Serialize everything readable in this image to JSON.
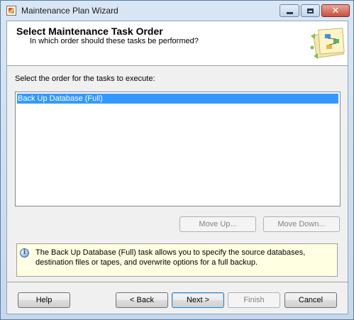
{
  "window": {
    "title": "Maintenance Plan Wizard",
    "app_icon": "wizard-app-icon"
  },
  "caption_buttons": {
    "minimize_icon": "minimize-icon",
    "maximize_icon": "maximize-icon",
    "close_icon": "close-icon",
    "close_glyph": "✕"
  },
  "header": {
    "title": "Select Maintenance Task Order",
    "subtitle": "In which order should these tasks be performed?",
    "graphic_icon": "wizard-header-graphic"
  },
  "task_section": {
    "label": "Select the order for the tasks to execute:",
    "tasks": [
      {
        "label": "Back Up Database (Full)",
        "selected": true
      }
    ]
  },
  "order_buttons": {
    "move_up": "Move Up...",
    "move_down": "Move Down..."
  },
  "info": {
    "icon": "info-icon",
    "glyph": "i",
    "text": "The Back Up Database (Full) task allows you to specify the source databases, destination files or tapes, and overwrite options for a full backup."
  },
  "footer": {
    "help": "Help",
    "back": "< Back",
    "next": "Next >",
    "finish": "Finish",
    "cancel": "Cancel"
  },
  "colors": {
    "selection": "#3399ff",
    "info_background": "#ffffe1",
    "close_button": "#c9503d"
  }
}
